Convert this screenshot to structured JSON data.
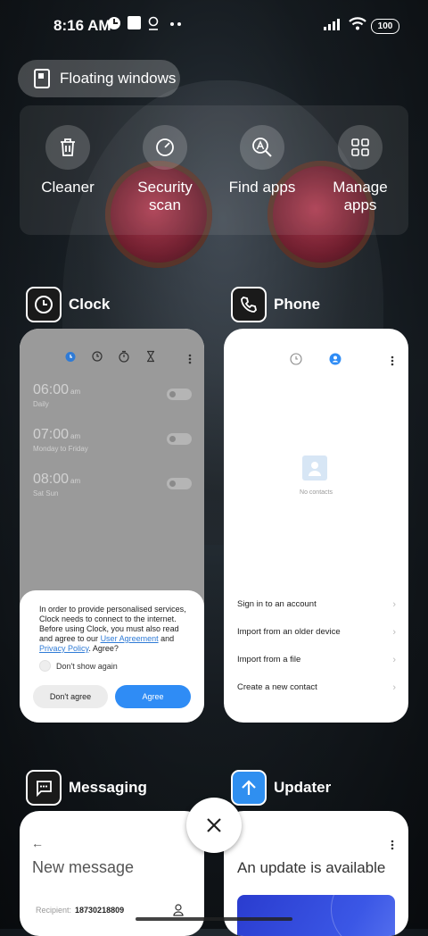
{
  "status_bar": {
    "time": "8:16 AM",
    "battery": "100"
  },
  "floating_windows": {
    "label": "Floating windows"
  },
  "quick_actions": [
    {
      "label": "Cleaner",
      "icon": "trash-icon"
    },
    {
      "label": "Security\nscan",
      "icon": "security-scan-icon"
    },
    {
      "label": "Find apps",
      "icon": "find-apps-icon"
    },
    {
      "label": "Manage\napps",
      "icon": "grid-icon"
    }
  ],
  "apps": {
    "clock": {
      "name": "Clock",
      "alarms": [
        {
          "time": "06:00",
          "ampm": "am",
          "repeat": "Daily"
        },
        {
          "time": "07:00",
          "ampm": "am",
          "repeat": "Monday to Friday"
        },
        {
          "time": "08:00",
          "ampm": "am",
          "repeat": "Sat Sun"
        }
      ],
      "consent": {
        "text_1": "In order to provide personalised services, Clock needs to connect to the internet. Before using Clock, you must also read and agree to our ",
        "link_1": "User Agreement",
        "and": " and ",
        "link_2": "Privacy Policy",
        "text_2": ". Agree?",
        "checkbox_label": "Don't show again",
        "decline": "Don't agree",
        "accept": "Agree"
      }
    },
    "phone": {
      "name": "Phone",
      "empty_text": "No contacts",
      "options": [
        "Sign in to an account",
        "Import from an older device",
        "Import from a file",
        "Create a new contact"
      ]
    },
    "messaging": {
      "name": "Messaging",
      "title": "New message",
      "recipient_label": "Recipient:",
      "recipient_value": "18730218809"
    },
    "updater": {
      "name": "Updater",
      "title": "An update is available"
    }
  },
  "colors": {
    "accent": "#2f8cf5",
    "updater_icon": "#2f8ff0"
  }
}
